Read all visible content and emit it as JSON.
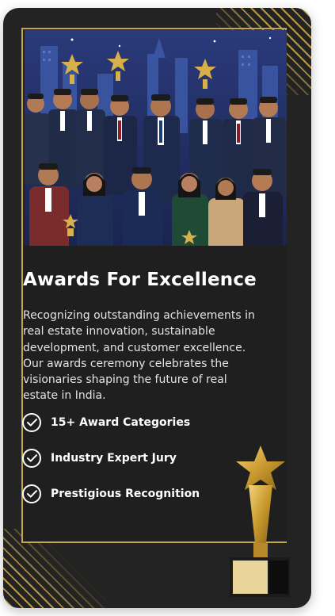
{
  "award_card": {
    "title": "Awards For Excellence",
    "description": "Recognizing outstanding achievements in real estate innovation, sustainable development, and customer excellence. Our awards ceremony celebrates the visionaries shaping the future of real estate in India.",
    "features": [
      {
        "label": "15+ Award Categories",
        "icon": "check-circle-icon"
      },
      {
        "label": "Industry Expert Jury",
        "icon": "check-circle-icon"
      },
      {
        "label": "Prestigious Recognition",
        "icon": "check-circle-icon"
      }
    ],
    "photo_subject": "group-of-award-winners-with-trophies",
    "decoration_icon": "gold-star-trophy-icon"
  },
  "colors": {
    "card_background": "#232323",
    "content_background": "#1f1f1f",
    "accent_gold": "#c9a54a",
    "text_primary": "#ffffff",
    "text_secondary": "#e4e4e4"
  }
}
